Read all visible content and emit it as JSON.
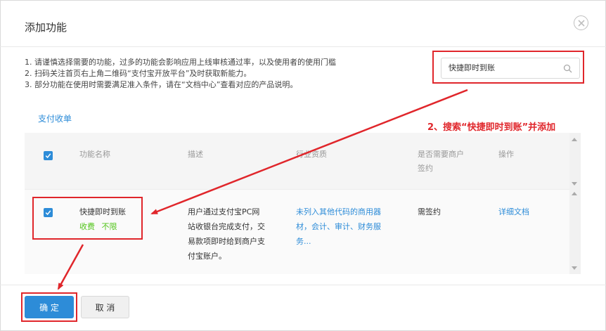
{
  "dialog": {
    "title": "添加功能",
    "close_icon": "close-icon"
  },
  "notes": [
    "1. 请谨慎选择需要的功能，过多的功能会影响应用上线审核通过率，以及使用者的使用门槛",
    "2. 扫码关注首页右上角二维码“支付宝开放平台”及时获取新能力。",
    "3. 部分功能在使用时需要满足准入条件，请在“文档中心”查看对应的产品说明。"
  ],
  "search": {
    "value": "快捷即时到账",
    "icon": "search-icon"
  },
  "category": "支付收单",
  "annotation": "2、搜索“快捷即时到账”并添加",
  "table": {
    "headers": {
      "name": "功能名称",
      "description": "描述",
      "qualification": "行业资质",
      "contract_line1": "是否需要商户",
      "contract_line2": "签约",
      "action": "操作"
    },
    "rows": [
      {
        "checked": true,
        "name": "快捷即时到账",
        "fee": "收费",
        "limit": "不限",
        "description_lines": [
          "用户通过支付宝PC网",
          "站收银台完成支付，交",
          "易款项即时给到商户支",
          "付宝账户。"
        ],
        "qualification_lines": [
          "未列入其他代码的商用器",
          "材，会计、审计、财务服",
          "务..."
        ],
        "contract": "需签约",
        "action": "详细文档"
      }
    ]
  },
  "footer": {
    "confirm_label": "确 定",
    "cancel_label": "取 消"
  },
  "colors": {
    "accent": "#2d8cd8",
    "annotation": "#e0262b",
    "tag_green": "#52c41a"
  }
}
